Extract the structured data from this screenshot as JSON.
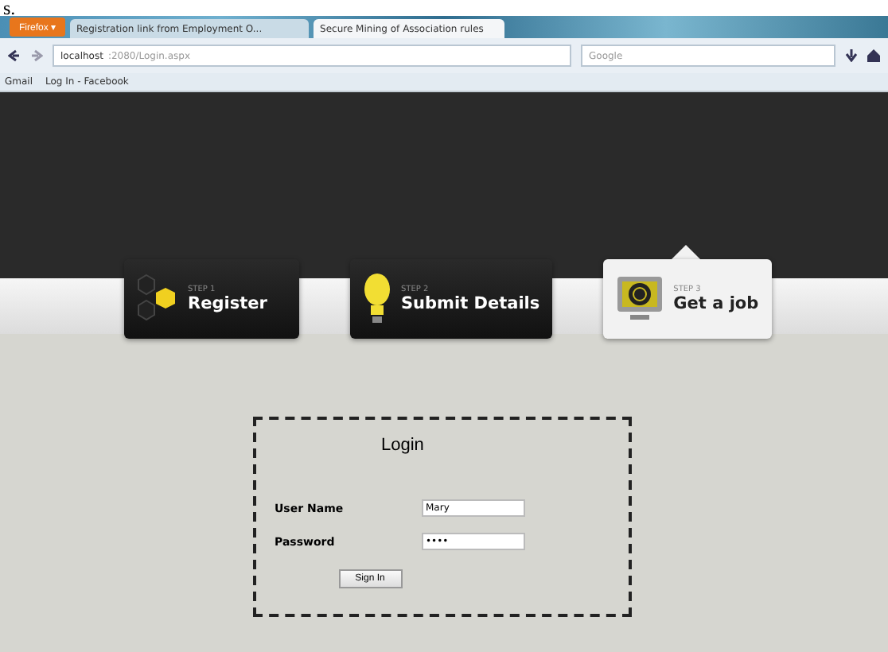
{
  "fragment": "s.",
  "browser": {
    "menu_button": "Firefox ▾",
    "tabs": [
      {
        "title": "Registration link from Employment O...",
        "selected": false
      },
      {
        "title": "Secure Mining of Association rules",
        "selected": true
      }
    ],
    "address": {
      "host": "localhost",
      "path": ":2080/Login.aspx"
    },
    "search": {
      "placeholder": "Google"
    },
    "bookmarks": [
      {
        "label": "Gmail"
      },
      {
        "label": "Log In - Facebook"
      }
    ]
  },
  "steps": [
    {
      "kind": "hexagons",
      "step": "STEP 1",
      "title": "Register",
      "selected": false
    },
    {
      "kind": "bulb",
      "step": "STEP 2",
      "title": "Submit Details",
      "selected": false
    },
    {
      "kind": "monitor",
      "step": "STEP 3",
      "title": "Get a job",
      "selected": true
    }
  ],
  "login": {
    "title": "Login",
    "fields": [
      {
        "label": "User Name",
        "value": "Mary"
      },
      {
        "label": "Password",
        "value": "••••"
      }
    ],
    "button": "Sign In"
  }
}
